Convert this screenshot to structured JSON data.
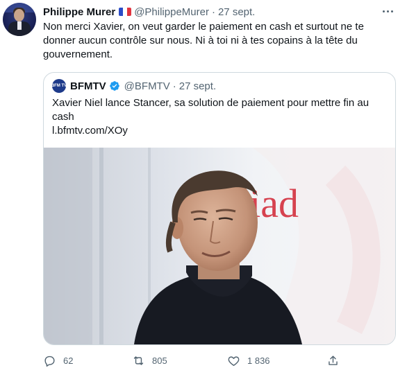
{
  "tweet": {
    "author_name": "Philippe Murer",
    "author_handle": "@PhilippeMurer",
    "separator": "·",
    "time": "27 sept.",
    "text": "Non merci Xavier, on veut garder le paiement en cash et surtout ne te donner aucun contrôle sur nous. Ni à toi ni à tes copains à la tête du gouvernement.",
    "flag_icon": "france-flag-icon",
    "more_icon": "more-options-icon"
  },
  "quoted": {
    "logo_text": "BFM TV",
    "author_name": "BFMTV",
    "author_handle": "@BFMTV",
    "separator": "·",
    "time": "27 sept.",
    "text": "Xavier Niel lance Stancer, sa solution de paiement pour mettre fin au cash",
    "link": "l.bfmtv.com/XOy",
    "image_sign_text": "liad",
    "verified_color": "#1d9bf0"
  },
  "actions": {
    "reply_count": "62",
    "retweet_count": "805",
    "like_count": "1 836"
  },
  "colors": {
    "text": "#0f1419",
    "secondary": "#536471",
    "border": "#cfd9de",
    "sign_red": "#d6424f"
  }
}
